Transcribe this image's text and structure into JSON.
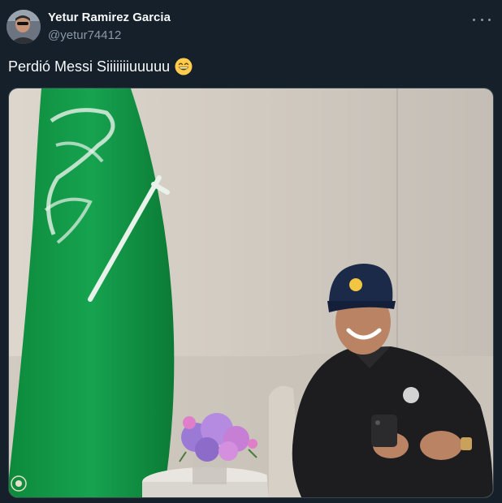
{
  "tweet": {
    "author": {
      "display_name": "Yetur Ramirez Garcia",
      "handle": "@yetur74412",
      "avatar_icon": "user-avatar"
    },
    "text": "Perdió Messi Siiiiiiiuuuuu",
    "emoji": "grinning-face-with-smiling-eyes",
    "more_icon": "more-options-icon",
    "media": {
      "type": "photo",
      "alt": ""
    }
  },
  "colors": {
    "background": "#15202b",
    "text_primary": "#f7f9f9",
    "text_secondary": "#8b98a5",
    "border": "#38444d"
  }
}
